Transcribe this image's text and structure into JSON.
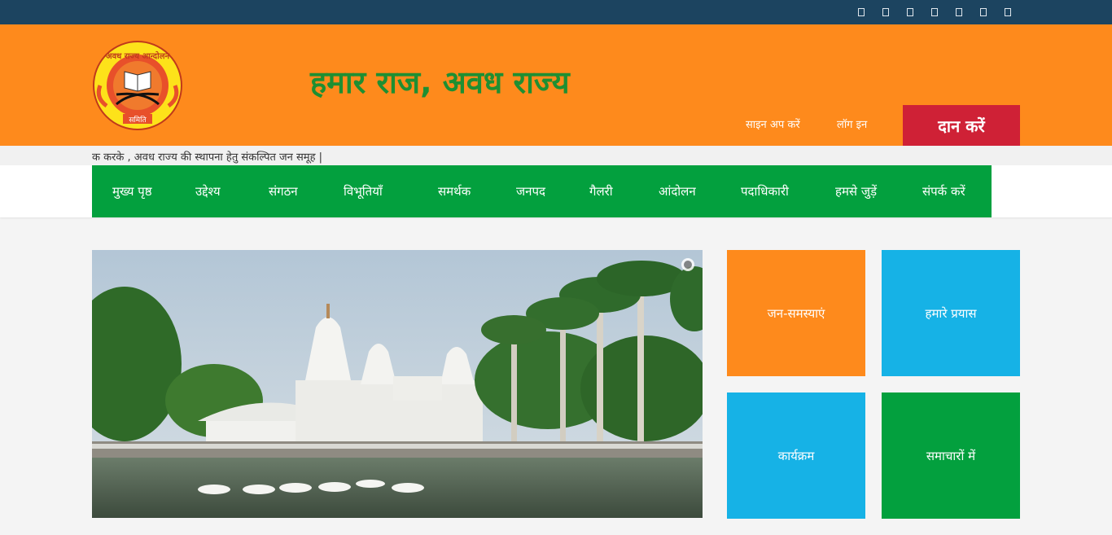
{
  "topbar": {
    "social_icons": [
      "facebook-icon",
      "twitter-icon",
      "google-plus-icon",
      "linkedin-icon",
      "youtube-icon",
      "instagram-icon",
      "pinterest-icon"
    ]
  },
  "header": {
    "site_title": "हमार राज, अवध राज्य",
    "logo_text_top": "अवध राज्य आन्दोलन",
    "logo_text_bottom": "समिति",
    "signup_label": "साइन अप करें",
    "login_label": "लॉग इन",
    "donate_label": "दान करें"
  },
  "ticker": {
    "text": "क करके , अवध राज्य की स्थापना हेतु संकल्पित जन समूह |"
  },
  "nav": {
    "items": [
      {
        "label": "मुख्य पृष्ठ"
      },
      {
        "label": "उद्देश्य"
      },
      {
        "label": "संगठन"
      },
      {
        "label": "विभूतियाँ"
      },
      {
        "label": "समर्थक"
      },
      {
        "label": "जनपद"
      },
      {
        "label": "गैलरी"
      },
      {
        "label": "आंदोलन"
      },
      {
        "label": "पदाधिकारी"
      },
      {
        "label": "हमसे जुड़ें"
      },
      {
        "label": "संपर्क करें"
      }
    ]
  },
  "tiles": [
    {
      "label": "जन-समस्याएं"
    },
    {
      "label": "हमारे प्रयास"
    },
    {
      "label": "कार्यक्रम"
    },
    {
      "label": "समाचारों में"
    }
  ],
  "colors": {
    "topbar": "#1c4460",
    "header": "#fe8a1c",
    "title_green": "#1e8f32",
    "nav_green": "#03a03e",
    "donate_red": "#cf2136",
    "tile_blue": "#16b2e6"
  }
}
